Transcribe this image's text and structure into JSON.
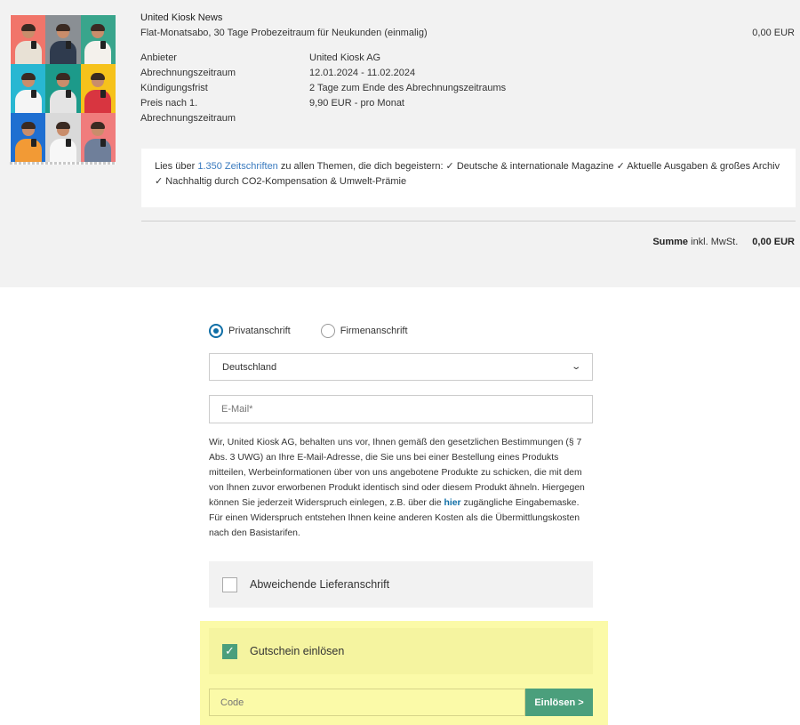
{
  "product": {
    "title": "United Kiosk News",
    "subtitle": "Flat-Monatsabo, 30 Tage Probezeitraum für Neukunden (einmalig)",
    "price": "0,00 EUR",
    "details": [
      {
        "label": "Anbieter",
        "value": "United Kiosk AG"
      },
      {
        "label": "Abrechnungszeitraum",
        "value": "12.01.2024 - 11.02.2024"
      },
      {
        "label": "Kündigungsfrist",
        "value": "2 Tage zum Ende des Abrechnungszeitraums"
      },
      {
        "label": "Preis nach 1. Abrechnungszeitraum",
        "value": "9,90 EUR - pro Monat"
      }
    ],
    "promo_prefix": "Lies über ",
    "promo_link": "1.350 Zeitschriften",
    "promo_suffix": " zu allen Themen, die dich begeistern: ✓ Deutsche & internationale Magazine ✓ Aktuelle Ausgaben & großes Archiv ✓ Nachhaltig durch CO2-Kompensation & Umwelt-Prämie"
  },
  "total": {
    "label": "Summe",
    "suffix": " inkl. MwSt.",
    "amount": "0,00 EUR"
  },
  "form": {
    "address_types": [
      {
        "label": "Privatanschrift",
        "selected": true
      },
      {
        "label": "Firmenanschrift",
        "selected": false
      }
    ],
    "country": "Deutschland",
    "email_placeholder": "E-Mail*",
    "legal_pre": "Wir, United Kiosk AG, behalten uns vor, Ihnen gemäß den gesetzlichen Bestimmungen (§ 7 Abs. 3 UWG) an Ihre E-Mail-Adresse, die Sie uns bei einer Bestellung eines Produkts mitteilen, Werbeinformationen über von uns angebotene Produkte zu schicken, die mit dem von Ihnen zuvor erworbenen Produkt identisch sind oder diesem Produkt ähneln. Hiergegen können Sie jederzeit Widerspruch einlegen, z.B. über die ",
    "legal_link": "hier",
    "legal_post": " zugängliche Eingabemaske. Für einen Widerspruch entstehen Ihnen keine anderen Kosten als die Übermittlungskosten nach den Basistarifen.",
    "alt_shipping_label": "Abweichende Lieferanschrift",
    "voucher_label": "Gutschein einlösen",
    "code_placeholder": "Code",
    "redeem_label": "Einlösen >"
  },
  "colors": {
    "accent": "#4b9f7c",
    "link": "#0f6ea6",
    "highlight": "#fbfaa8"
  },
  "thumbnail_tiles": [
    {
      "bg": "#f1756a",
      "shirt": "#e8e1d5"
    },
    {
      "bg": "#8a8f94",
      "shirt": "#2f3b4e"
    },
    {
      "bg": "#39a58c",
      "shirt": "#f4f1ec"
    },
    {
      "bg": "#28b7d2",
      "shirt": "#f5f5f5"
    },
    {
      "bg": "#1c9a8a",
      "shirt": "#e4e4e4"
    },
    {
      "bg": "#f6c21b",
      "shirt": "#d83540"
    },
    {
      "bg": "#1f6fd1",
      "shirt": "#f29a35"
    },
    {
      "bg": "#d9d9d9",
      "shirt": "#f7f7f7"
    },
    {
      "bg": "#f07c7c",
      "shirt": "#6f7f9a"
    }
  ]
}
